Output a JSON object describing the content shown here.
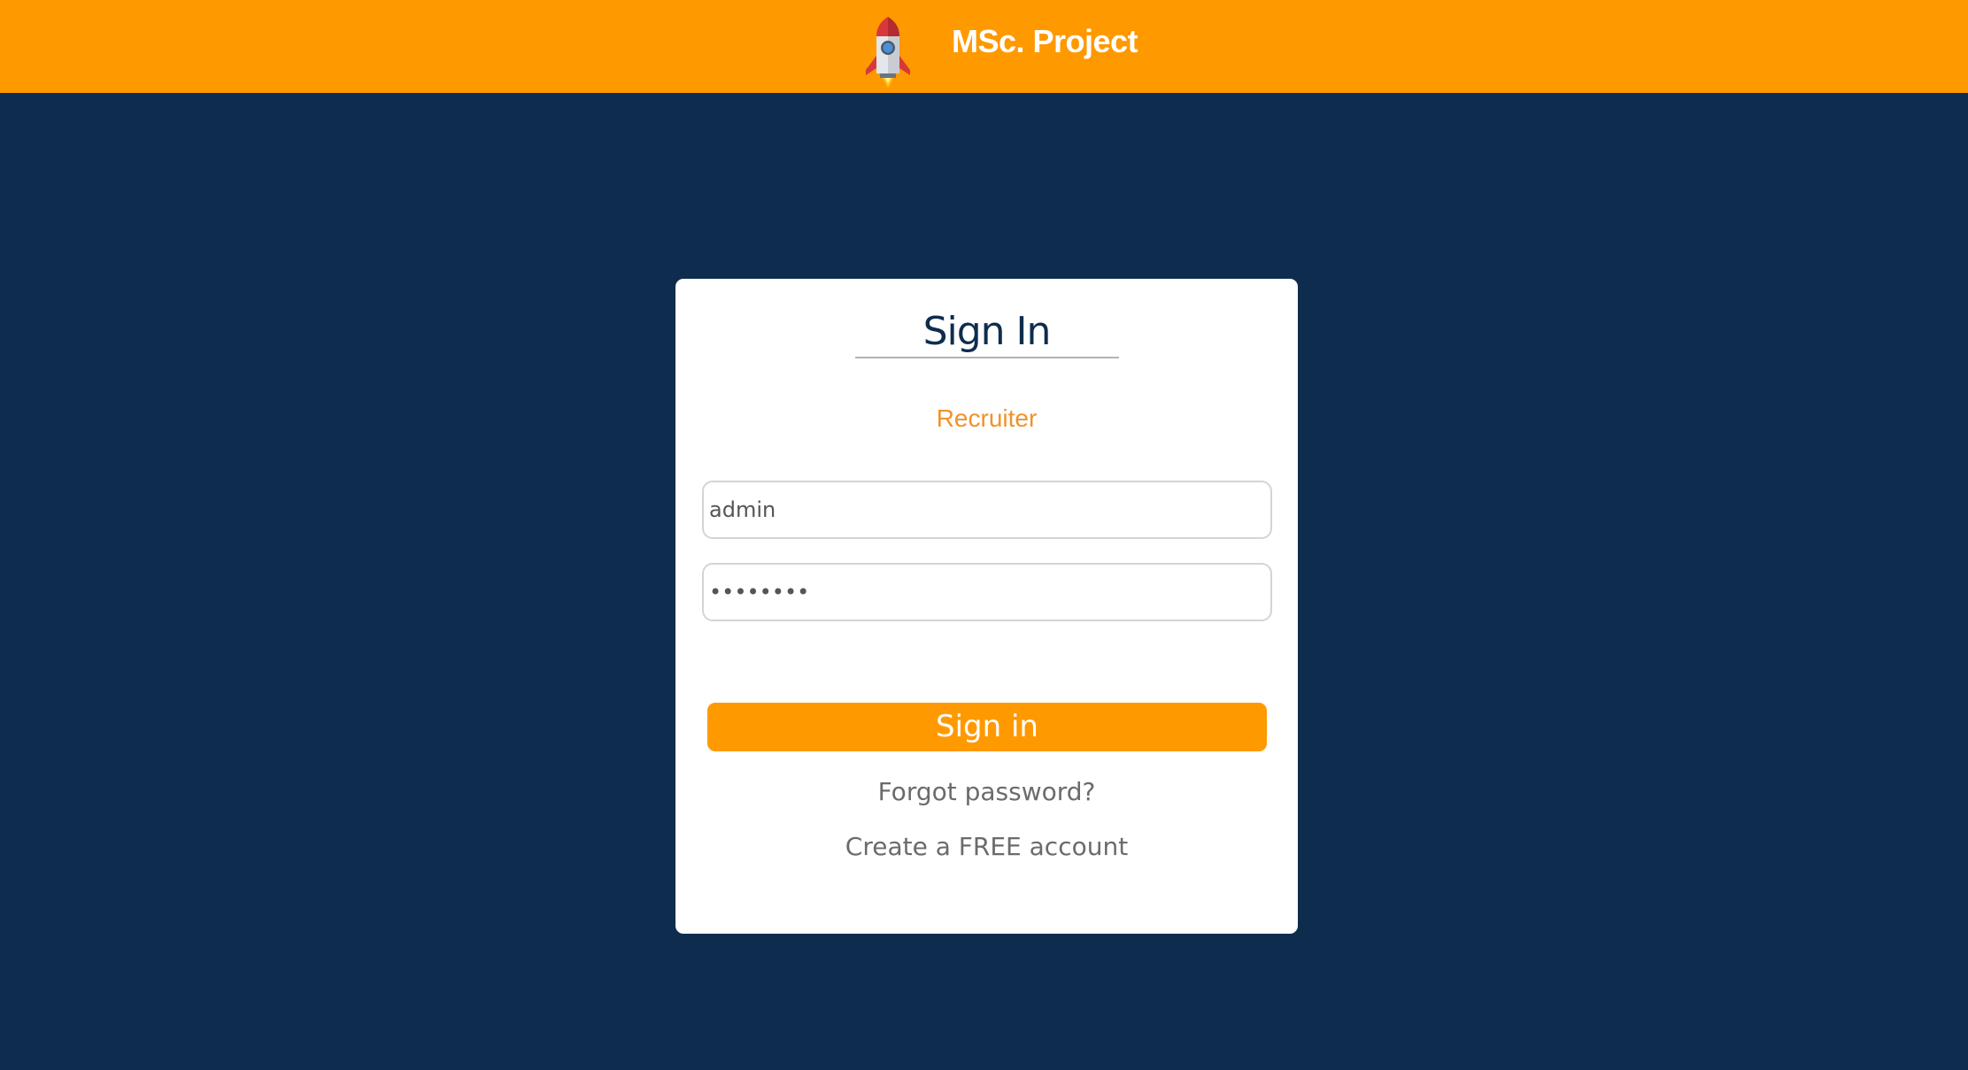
{
  "header": {
    "brand_title": "MSc. Project",
    "logo_icon": "rocket-icon",
    "background_color": "#ff9900"
  },
  "signin_card": {
    "title": "Sign In",
    "role_label": "Recruiter",
    "username": {
      "value": "admin"
    },
    "password": {
      "value": "........"
    },
    "submit_label": "Sign in",
    "forgot_password_label": "Forgot password?",
    "create_account_label": "Create a FREE account"
  },
  "colors": {
    "page_background": "#0e2d4e",
    "accent": "#ff9900",
    "card_background": "#ffffff",
    "title_text": "#0e2d4e",
    "link_text": "#6b6b6b"
  }
}
